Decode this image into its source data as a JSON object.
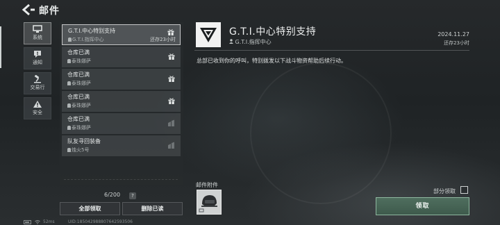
{
  "header": {
    "title": "邮件"
  },
  "sidebar": {
    "items": [
      {
        "label": "系统",
        "icon": "monitor-icon",
        "active": true
      },
      {
        "label": "通知",
        "icon": "alert-bubble-icon",
        "active": false
      },
      {
        "label": "交易行",
        "icon": "gavel-icon",
        "active": false
      },
      {
        "label": "安全",
        "icon": "warning-icon",
        "active": false
      }
    ]
  },
  "mail_list": {
    "items": [
      {
        "subject": "G.T.I.中心特别支持",
        "sender": "G.T.I.指挥中心",
        "expiry": "还存23小时",
        "icon": "gift-icon",
        "selected": true
      },
      {
        "subject": "仓库已满",
        "sender": "泰珠娜萨",
        "icon": "gift-icon"
      },
      {
        "subject": "仓库已满",
        "sender": "泰珠娜萨",
        "icon": "gift-icon"
      },
      {
        "subject": "仓库已满",
        "sender": "泰珠娜萨",
        "icon": "gift-icon"
      },
      {
        "subject": "仓库已满",
        "sender": "泰珠娜萨",
        "icon": "claimed-icon"
      },
      {
        "subject": "队友寻回装备",
        "sender": "烛火5号",
        "icon": "claimed-icon"
      }
    ],
    "count": "6/200",
    "help": "?",
    "claim_all": "全部领取",
    "delete_read": "删除已读"
  },
  "detail": {
    "title": "G.T.I.中心特别支持",
    "sender": "G.T.I.指挥中心",
    "date": "2024.11.27",
    "expiry": "还存23小时",
    "body": "总部已收到你的呼叫，特别拨发以下战斗物资帮助后续行动。",
    "attachments_label": "邮件附件",
    "partial_claim": "部分领取",
    "claim_button": "领取"
  },
  "footer": {
    "ping": "52ms",
    "uid": "UID:185042988807642593506"
  },
  "colors": {
    "claim_accent": "#4f6e5e",
    "selected_border": "#f0f0f0"
  }
}
